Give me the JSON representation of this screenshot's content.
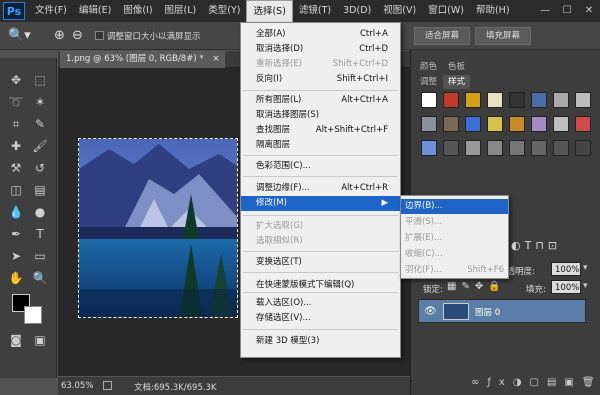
{
  "app": {
    "logo": "Ps"
  },
  "menubar": {
    "items": [
      "文件(F)",
      "编辑(E)",
      "图像(I)",
      "图层(L)",
      "类型(Y)",
      "选择(S)",
      "滤镜(T)",
      "3D(D)",
      "视图(V)",
      "窗口(W)",
      "帮助(H)"
    ],
    "active_index": 5,
    "win_controls": [
      "—",
      "☐",
      "✕"
    ]
  },
  "options": {
    "zoom_in": "⊕",
    "zoom_out": "⊖",
    "resize_window_label": "调整窗口大小以满屏显示",
    "fit_screen": "适合屏幕",
    "fill_screen": "填充屏幕"
  },
  "document": {
    "tab_title": "1.png @ 63% (图层 0, RGB/8#) *",
    "tab_close": "×"
  },
  "status": {
    "zoom": "63.05%",
    "doc_info": "文档:695.3K/695.3K"
  },
  "select_menu": {
    "items": [
      {
        "label": "全部(A)",
        "shortcut": "Ctrl+A",
        "disabled": false
      },
      {
        "label": "取消选择(D)",
        "shortcut": "Ctrl+D",
        "disabled": false
      },
      {
        "label": "重新选择(E)",
        "shortcut": "Shift+Ctrl+D",
        "disabled": true
      },
      {
        "label": "反向(I)",
        "shortcut": "Shift+Ctrl+I",
        "disabled": false
      },
      {
        "label": "所有图层(L)",
        "shortcut": "Alt+Ctrl+A",
        "disabled": false
      },
      {
        "label": "取消选择图层(S)",
        "shortcut": "",
        "disabled": false
      },
      {
        "label": "查找图层",
        "shortcut": "Alt+Shift+Ctrl+F",
        "disabled": false
      },
      {
        "label": "隔离图层",
        "shortcut": "",
        "disabled": false
      },
      {
        "label": "色彩范围(C)...",
        "shortcut": "",
        "disabled": false
      },
      {
        "label": "调整边缘(F)...",
        "shortcut": "Alt+Ctrl+R",
        "disabled": false
      },
      {
        "label": "修改(M)",
        "shortcut": "",
        "disabled": false
      },
      {
        "label": "扩大选取(G)",
        "shortcut": "",
        "disabled": true
      },
      {
        "label": "选取相似(R)",
        "shortcut": "",
        "disabled": true
      },
      {
        "label": "变换选区(T)",
        "shortcut": "",
        "disabled": false
      },
      {
        "label": "在快速蒙版模式下编辑(Q)",
        "shortcut": "",
        "disabled": false
      },
      {
        "label": "载入选区(O)...",
        "shortcut": "",
        "disabled": false
      },
      {
        "label": "存储选区(V)...",
        "shortcut": "",
        "disabled": false
      },
      {
        "label": "新建 3D 模型(3)",
        "shortcut": "",
        "disabled": false
      }
    ],
    "submenu_arrow": "▶"
  },
  "modify_submenu": {
    "items": [
      {
        "label": "边界(B)...",
        "shortcut": ""
      },
      {
        "label": "平滑(S)...",
        "shortcut": ""
      },
      {
        "label": "扩展(E)...",
        "shortcut": ""
      },
      {
        "label": "收缩(C)...",
        "shortcut": ""
      },
      {
        "label": "羽化(F)...",
        "shortcut": "Shift+F6"
      }
    ]
  },
  "panels": {
    "tab_color": "颜色",
    "tab_swatches": "色板",
    "tab_adjust": "调整",
    "tab_styles": "样式",
    "opacity_label": "不透明度:",
    "opacity_value": "100%",
    "lock_label": "锁定:",
    "fill_label": "填充:",
    "fill_value": "100%",
    "layer_name": "图层 0",
    "dropdown_arrow": "▾"
  },
  "colors": {
    "highlight": "#1e63c8",
    "menu_bg": "#efefef"
  }
}
